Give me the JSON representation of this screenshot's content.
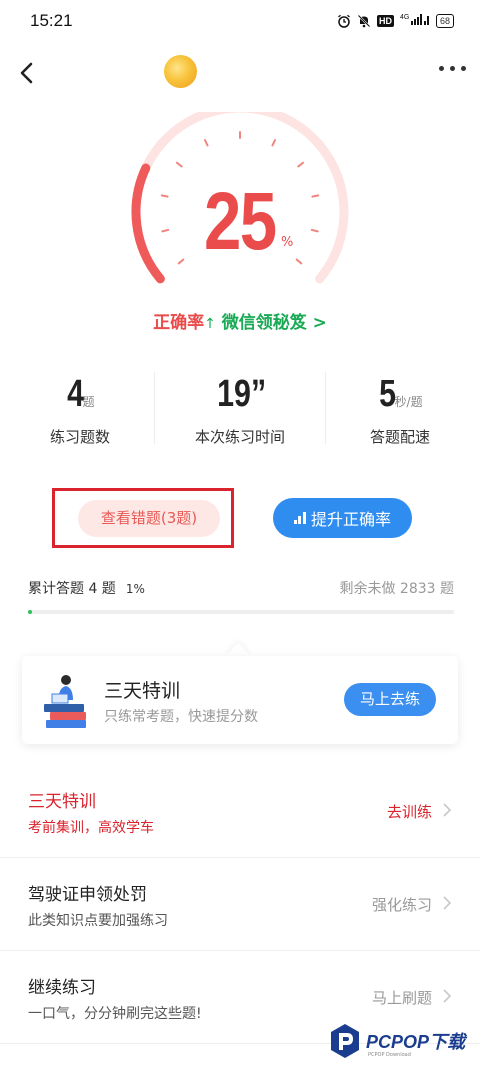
{
  "status_bar": {
    "time": "15:21",
    "icons": [
      "alarm-icon",
      "mute-bell-icon",
      "hd-icon",
      "4g-signal-icon",
      "battery-icon"
    ],
    "hd_label": "HD",
    "network_label": "⁴⁶ᴳ",
    "battery": "68"
  },
  "gauge": {
    "rate_value": "25",
    "rate_unit": "%",
    "rate_fraction": 0.25,
    "colors": {
      "active": "#ef5a5a",
      "inactive": "#fde3e1",
      "ticks": "#f0867f"
    }
  },
  "rate_line": {
    "label": "正确率",
    "arrow": "↑",
    "wechat_link": "微信领秘笈 >"
  },
  "stats": [
    {
      "value": "4",
      "unit": "题",
      "label": "练习题数"
    },
    {
      "value": "19”",
      "unit": "",
      "label": "本次练习时间"
    },
    {
      "value": "5",
      "unit": "秒/题",
      "label": "答题配速"
    }
  ],
  "buttons": {
    "view_mistakes": "查看错题(3题)",
    "improve_rate": "提升正确率"
  },
  "progress": {
    "total_label": "累计答题 4 题",
    "percent": "1%",
    "percent_value": 1,
    "remaining": "剩余未做 2833 题"
  },
  "promo_card": {
    "title": "三天特训",
    "subtitle": "只练常考题，快速提分数",
    "button": "马上去练"
  },
  "list": [
    {
      "title": "三天特训",
      "subtitle": "考前集训，高效学车",
      "action": "去训练"
    },
    {
      "title": "驾驶证申领处罚",
      "subtitle": "此类知识点要加强练习",
      "action": "强化练习"
    },
    {
      "title": "继续练习",
      "subtitle": "一口气，分分钟刷完这些题!",
      "action": "马上刷题"
    }
  ],
  "watermark": {
    "text": "PCPOP下载",
    "small": "PCPOP Download"
  },
  "colors": {
    "accent_red": "#ea4b4b",
    "highlight_red": "#d9232d",
    "accent_green": "#1aaa55",
    "accent_blue": "#2f8df0"
  }
}
